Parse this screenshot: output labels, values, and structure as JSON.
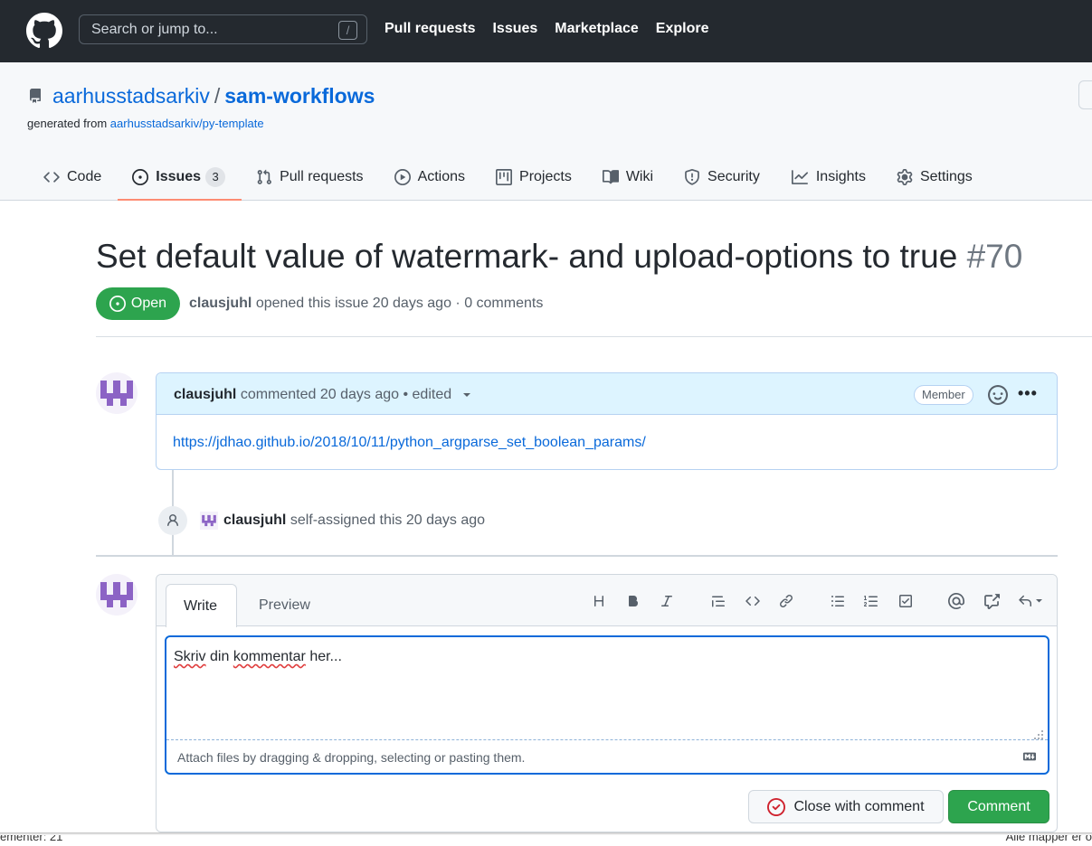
{
  "header": {
    "search_placeholder": "Search or jump to...",
    "search_shortcut": "/",
    "nav": [
      "Pull requests",
      "Issues",
      "Marketplace",
      "Explore"
    ]
  },
  "repo": {
    "owner": "aarhusstadsarkiv",
    "separator": "/",
    "name": "sam-workflows",
    "generated_prefix": "generated from",
    "generated_from": "aarhusstadsarkiv/py-template"
  },
  "tabs": [
    {
      "label": "Code",
      "icon": "code-icon"
    },
    {
      "label": "Issues",
      "icon": "issue-opened-icon",
      "count": "3",
      "selected": true
    },
    {
      "label": "Pull requests",
      "icon": "git-pull-request-icon"
    },
    {
      "label": "Actions",
      "icon": "play-icon"
    },
    {
      "label": "Projects",
      "icon": "project-icon"
    },
    {
      "label": "Wiki",
      "icon": "book-icon"
    },
    {
      "label": "Security",
      "icon": "shield-icon"
    },
    {
      "label": "Insights",
      "icon": "graph-icon"
    },
    {
      "label": "Settings",
      "icon": "gear-icon"
    }
  ],
  "issue": {
    "title": "Set default value of watermark- and upload-options to true",
    "number": "#70",
    "state": "Open",
    "author": "clausjuhl",
    "meta_rest": "opened this issue 20 days ago · 0 comments"
  },
  "comment": {
    "author": "clausjuhl",
    "meta": "commented 20 days ago • edited",
    "role": "Member",
    "body_link": "https://jdhao.github.io/2018/10/11/python_argparse_set_boolean_params/",
    "more": "•••"
  },
  "timeline": {
    "actor": "clausjuhl",
    "event": "self-assigned this 20 days ago"
  },
  "editor": {
    "tab_write": "Write",
    "tab_preview": "Preview",
    "text_words": [
      "Skriv",
      "din",
      "kommentar",
      "her..."
    ],
    "attach_hint": "Attach files by dragging & dropping, selecting or pasting them.",
    "close_button": "Close with comment",
    "comment_button": "Comment"
  },
  "statusbar": {
    "left": "ementer: 21",
    "right": "Alle mapper er o"
  },
  "colors": {
    "header_bg": "#24292f",
    "link": "#0969da",
    "open_green": "#2da44e",
    "tab_underline": "#fd8c73",
    "comment_header": "#ddf4ff"
  }
}
